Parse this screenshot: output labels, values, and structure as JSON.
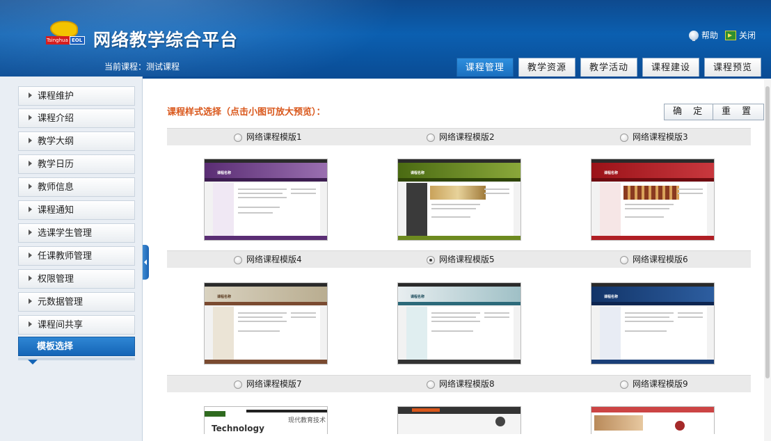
{
  "header": {
    "title": "网络教学综合平台",
    "logo": {
      "name": "tsinghua-logo",
      "text_left": "Tsinghua",
      "text_right": "EOL"
    },
    "current_course_label": "当前课程：",
    "current_course_value": "测试课程",
    "links": [
      {
        "label": "帮助",
        "icon": "help-icon"
      },
      {
        "label": "关闭",
        "icon": "exit-icon"
      }
    ],
    "tabs": [
      {
        "label": "课程管理",
        "active": true
      },
      {
        "label": "教学资源",
        "active": false
      },
      {
        "label": "教学活动",
        "active": false
      },
      {
        "label": "课程建设",
        "active": false
      },
      {
        "label": "课程预览",
        "active": false
      }
    ]
  },
  "sidebar": {
    "items": [
      {
        "label": "课程维护"
      },
      {
        "label": "课程介绍"
      },
      {
        "label": "教学大纲"
      },
      {
        "label": "教学日历"
      },
      {
        "label": "教师信息"
      },
      {
        "label": "课程通知"
      },
      {
        "label": "选课学生管理"
      },
      {
        "label": "任课教师管理"
      },
      {
        "label": "权限管理"
      },
      {
        "label": "元数据管理"
      },
      {
        "label": "课程间共享"
      },
      {
        "label": "模板选择",
        "active": true
      }
    ]
  },
  "main": {
    "section_title": "课程样式选择（点击小图可放大预览）：",
    "buttons": {
      "confirm": "确 定",
      "reset": "重 置"
    },
    "selected_template": "网络课程模版5",
    "templates": [
      {
        "label": "网络课程模版1",
        "checked": false,
        "theme": "purple"
      },
      {
        "label": "网络课程模版2",
        "checked": false,
        "theme": "olive"
      },
      {
        "label": "网络课程模版3",
        "checked": false,
        "theme": "red"
      },
      {
        "label": "网络课程模版4",
        "checked": false,
        "theme": "brown"
      },
      {
        "label": "网络课程模版5",
        "checked": true,
        "theme": "teal"
      },
      {
        "label": "网络课程模版6",
        "checked": false,
        "theme": "navy"
      },
      {
        "label": "网络课程模版7",
        "checked": false,
        "theme": "green-white"
      },
      {
        "label": "网络课程模版8",
        "checked": false,
        "theme": "gray"
      },
      {
        "label": "网络课程模版9",
        "checked": false,
        "theme": "light-red"
      }
    ],
    "thumbnail_texts": {
      "course_name": "课程名称",
      "template7_word": "Technology",
      "template7_headline": "现代教育技术"
    }
  },
  "colors": {
    "header_blue": "#0b5fb0",
    "active_tab": "#1a6fbf",
    "section_title": "#d9571b",
    "purple": "#6b3f86",
    "olive": "#6d8a1f",
    "red": "#b01e24",
    "brown": "#7a4a30",
    "teal": "#2c6a7a",
    "navy": "#1a3f78"
  }
}
